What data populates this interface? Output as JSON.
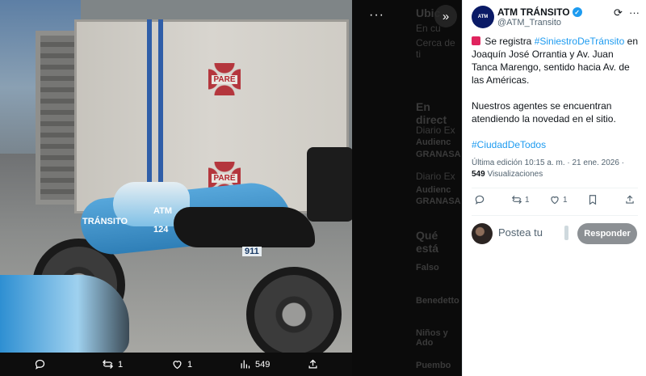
{
  "post": {
    "author_name": "ATM TRÁNSITO",
    "author_handle": "@ATM_Transito",
    "avatar_text": "ATM",
    "text_prefix": " Se registra ",
    "hashtag_1": "#SiniestroDeTránsito",
    "text_middle": " en Joaquín José Orrantia y Av. Juan Tanca Marengo, sentido hacia Av. de las Américas.",
    "paragraph_2": "Nuestros agentes se encuentran atendiendo la novedad en el sitio.",
    "hashtag_2": "#CiudadDeTodos",
    "edited": "Última edición 10:15 a. m. · 21 ene. 2026 ·",
    "views_count": "549",
    "views_label": " Visualizaciones",
    "reposts": "1",
    "likes": "1"
  },
  "reply": {
    "placeholder": "Postea tu",
    "button": "Responder"
  },
  "media_bar": {
    "reposts": "1",
    "likes": "1",
    "views": "549"
  },
  "photo_labels": {
    "pare_1": "PARE",
    "pare_2": "PARE",
    "transito": "TRÁNSITO",
    "unit": "124",
    "plate": "911",
    "atm": "ATM"
  },
  "background_text": {
    "line_1": "Ubic",
    "line_2": "En cu",
    "line_3": "Cerca de ti",
    "line_4": "En direct",
    "line_5": "Diario Ex",
    "line_6": "Audienc",
    "line_7": "GRANASA",
    "line_8": "Diario Ex",
    "line_9": "Audienc",
    "line_10": "GRANASA",
    "line_11": "Qué está",
    "line_12": "Falso",
    "line_13": "Benedetto",
    "line_14": "Niños y Ado",
    "line_15": "Puembo"
  },
  "colors": {
    "accent": "#1d9bf0",
    "alert": "#e0245e",
    "reply_button": "#8c9094"
  }
}
